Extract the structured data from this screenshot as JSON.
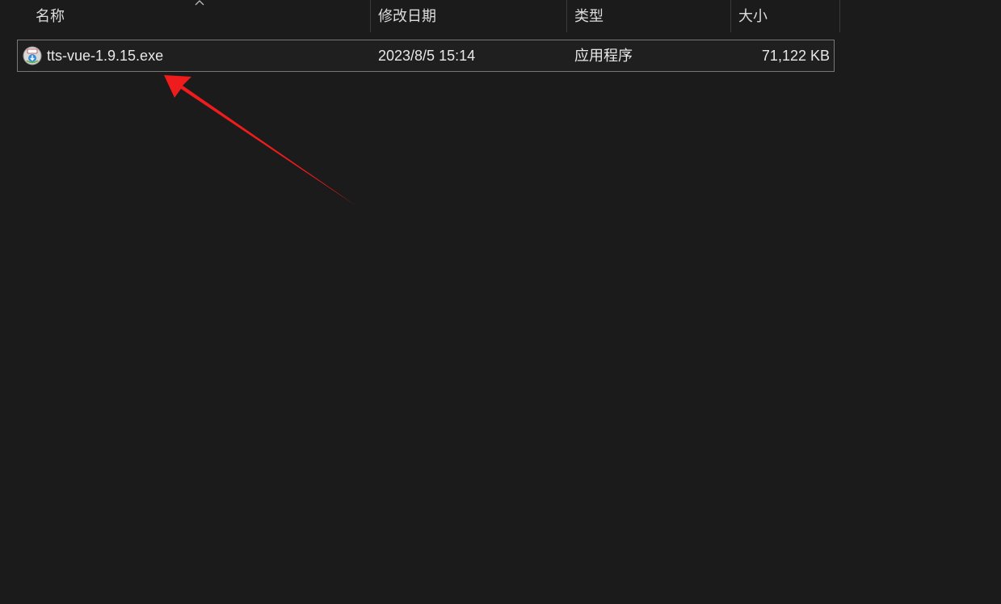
{
  "columns": {
    "name": "名称",
    "date_modified": "修改日期",
    "type": "类型",
    "size": "大小"
  },
  "sort": {
    "column": "name",
    "direction": "ascending",
    "icon": "chevron-up-icon"
  },
  "files": [
    {
      "name": "tts-vue-1.9.15.exe",
      "date_modified": "2023/8/5 15:14",
      "type": "应用程序",
      "size": "71,122 KB",
      "icon": "installer-exe-icon",
      "selected": true
    }
  ],
  "annotation": {
    "type": "arrow",
    "color": "#ee1c1c",
    "points_to": "files.0.name"
  }
}
